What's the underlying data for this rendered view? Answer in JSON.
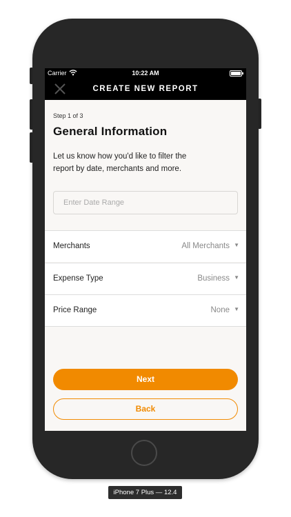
{
  "status_bar": {
    "carrier": "Carrier",
    "time": "10:22 AM"
  },
  "nav": {
    "title": "CREATE NEW REPORT",
    "close_icon": "close-icon"
  },
  "form": {
    "step": "Step 1 of 3",
    "heading": "General Information",
    "description": "Let us know how you'd like to filter the report by date, merchants and more.",
    "date_placeholder": "Enter Date Range",
    "rows": [
      {
        "label": "Merchants",
        "value": "All Merchants"
      },
      {
        "label": "Expense Type",
        "value": "Business"
      },
      {
        "label": "Price Range",
        "value": "None"
      }
    ],
    "dropdown_arrow": "▼"
  },
  "buttons": {
    "next": "Next",
    "back": "Back"
  },
  "device": {
    "label": "iPhone 7 Plus — 12.4"
  },
  "colors": {
    "accent": "#f18a00",
    "nav_bg": "#000000",
    "screen_bg": "#f9f7f5",
    "device_body": "#272727"
  }
}
